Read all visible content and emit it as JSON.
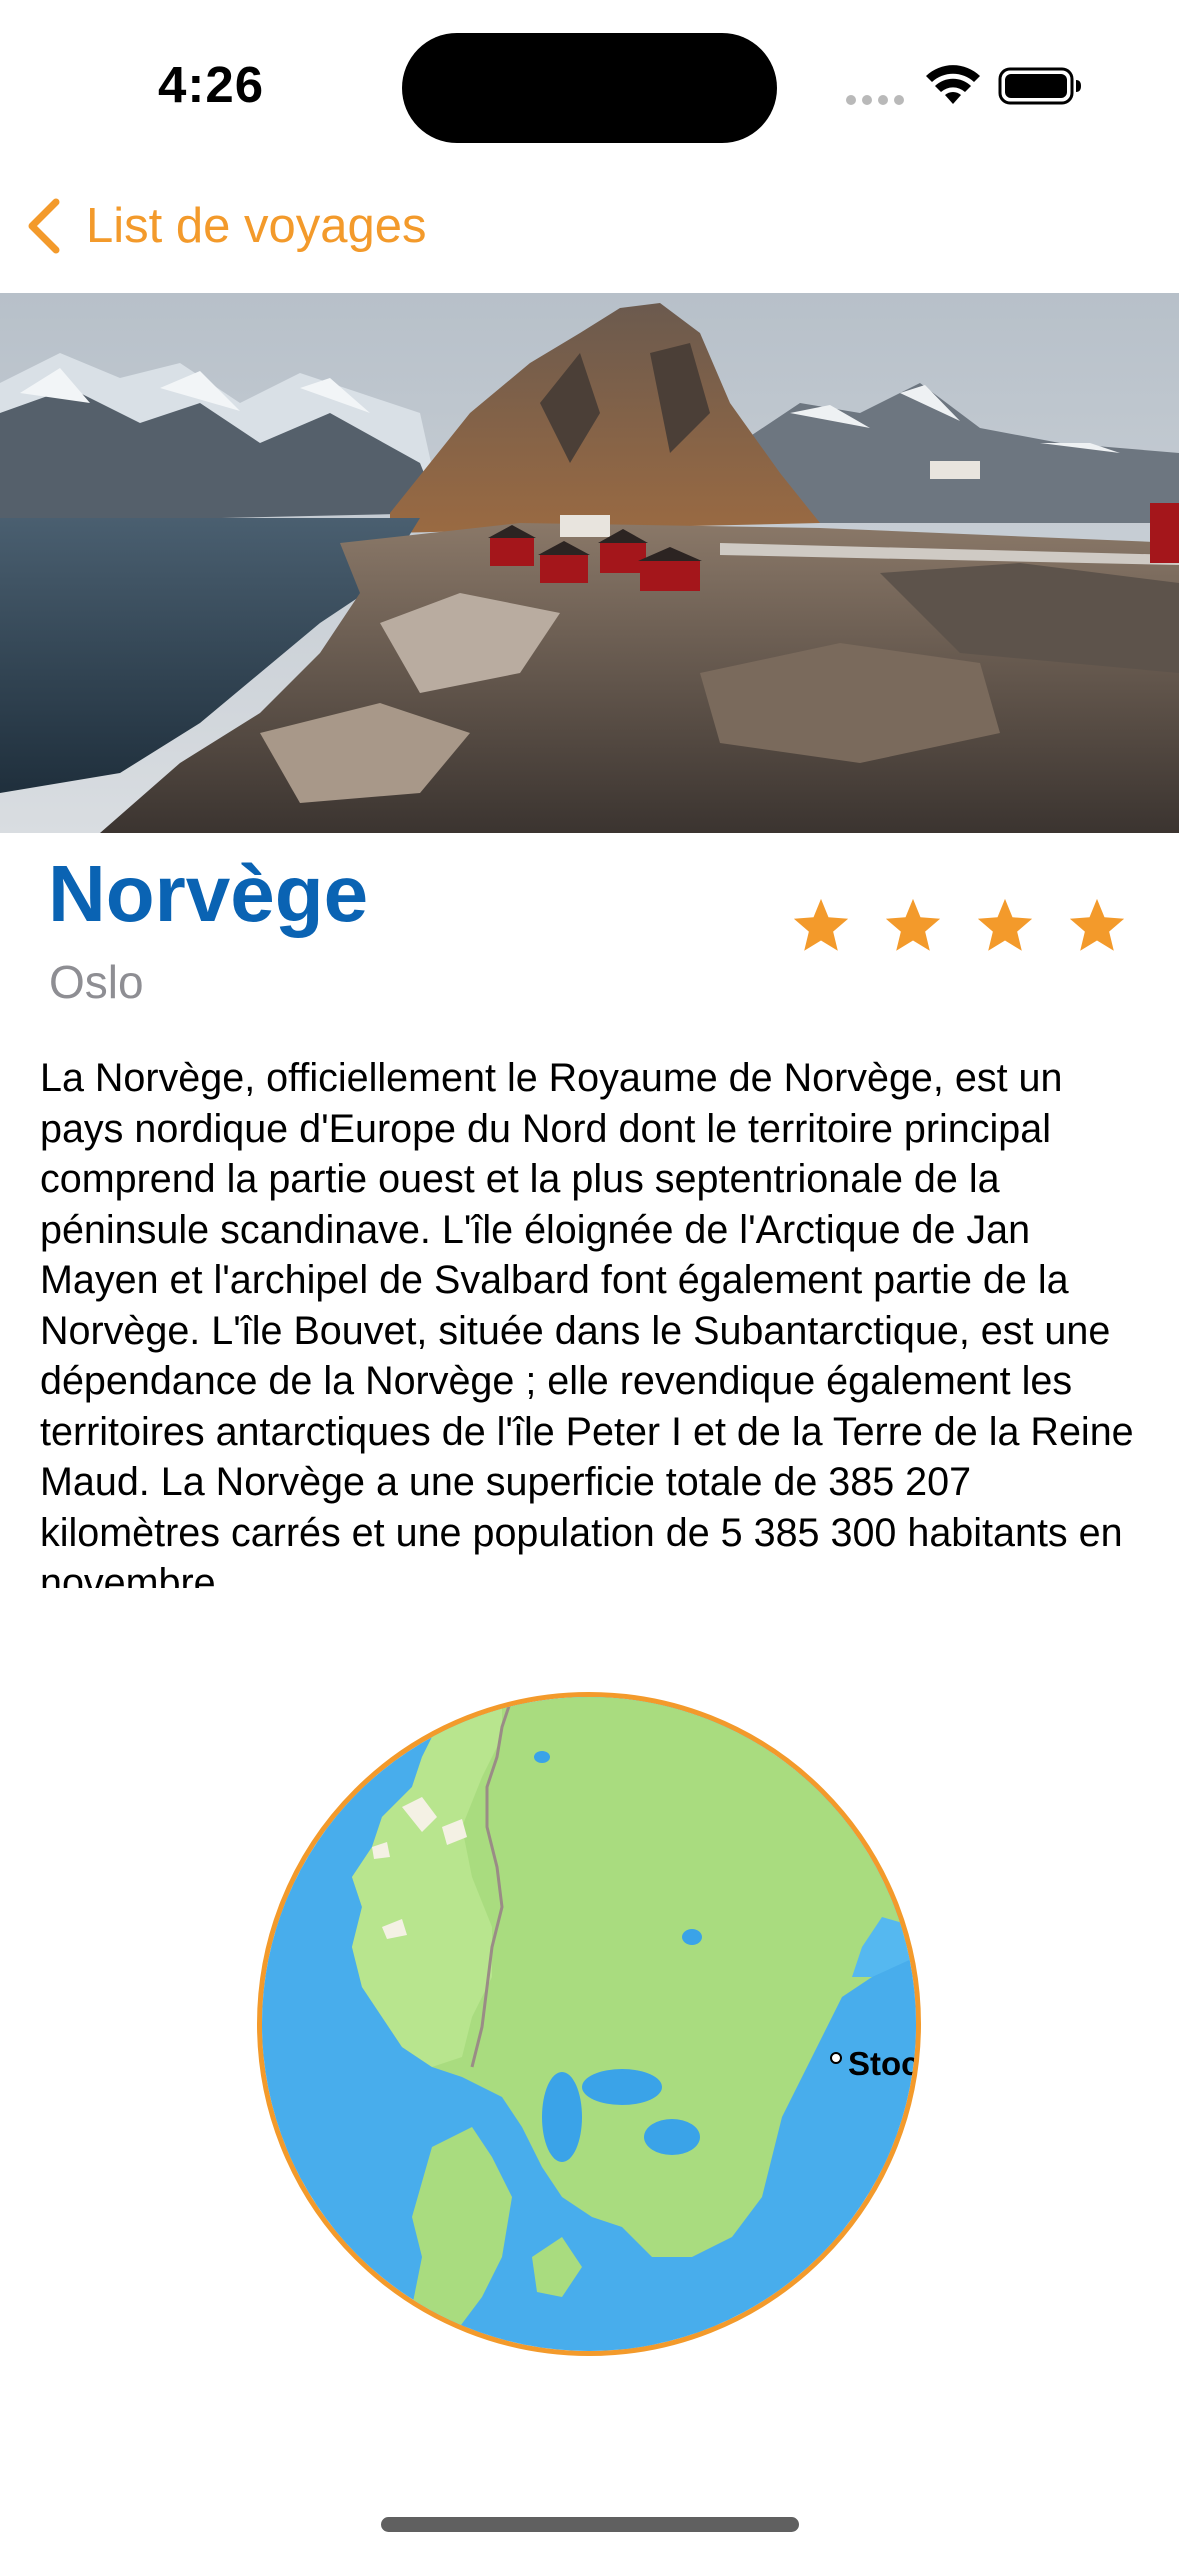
{
  "status_bar": {
    "time": "4:26"
  },
  "nav": {
    "back_label": "List de voyages",
    "back_icon": "chevron-left-icon"
  },
  "hero": {
    "image": "norway-lofoten-landscape"
  },
  "destination": {
    "country": "Norvège",
    "city": "Oslo",
    "rating": 4,
    "description": "La Norvège, officiellement le Royaume de Norvège, est un pays nordique d'Europe du Nord dont le territoire principal comprend la partie ouest et la plus septentrionale de la péninsule scandinave. L'île éloignée de l'Arctique de Jan Mayen et l'archipel de Svalbard font également partie de la Norvège. L'île Bouvet, située dans le Subantarctique, est une dépendance de la Norvège ; elle revendique également les territoires antarctiques de l'île Peter I et de la Terre de la Reine Maud. La Norvège a une superficie totale de 385 207 kilomètres carrés et une population de 5 385 300 habitants en novembre"
  },
  "map": {
    "city_label": "Stoc"
  },
  "colors": {
    "accent": "#F39A2B",
    "title": "#0A63B3",
    "subtitle": "#8E8E93"
  }
}
